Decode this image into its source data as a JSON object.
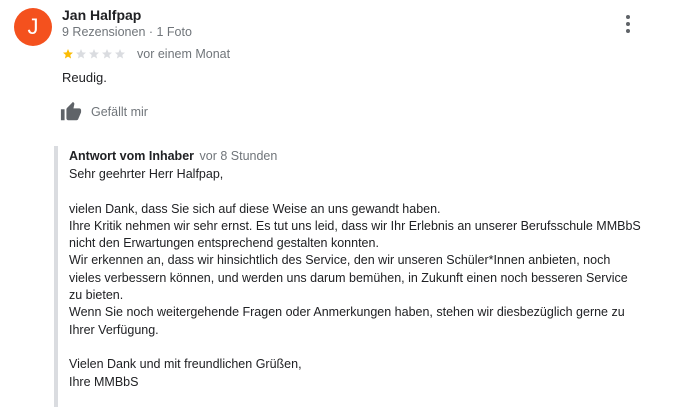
{
  "review": {
    "author": {
      "avatar_letter": "J",
      "avatar_color": "#f4511e",
      "name": "Jan Halfpap",
      "meta": "9 Rezensionen · 1 Foto"
    },
    "more_icon": "more-vert-icon",
    "rating": {
      "value": 1,
      "max": 5,
      "filled_color": "#fbbc04",
      "empty_color": "#dadce0"
    },
    "time": "vor einem Monat",
    "text": "Reudig.",
    "like": {
      "icon": "thumb-up-icon",
      "label": "Gefällt mir"
    }
  },
  "owner_response": {
    "title": "Antwort vom Inhaber",
    "time": "vor 8 Stunden",
    "lines": [
      "Sehr geehrter Herr Halfpap,",
      "",
      "vielen Dank, dass Sie sich auf diese Weise an uns gewandt haben.",
      "Ihre Kritik nehmen wir sehr ernst. Es tut uns leid, dass wir Ihr Erlebnis an unserer Berufsschule MMBbS",
      "nicht den Erwartungen entsprechend gestalten konnten.",
      "Wir erkennen an, dass wir hinsichtlich des Service, den wir unseren Schüler*Innen anbieten, noch",
      "vieles verbessern können, und werden uns darum bemühen, in Zukunft einen noch besseren Service",
      "zu bieten.",
      "Wenn Sie noch weitergehende Fragen oder Anmerkungen haben, stehen wir diesbezüglich gerne zu",
      "Ihrer Verfügung.",
      "",
      "Vielen Dank und mit freundlichen Grüßen,",
      "Ihre MMBbS"
    ]
  }
}
